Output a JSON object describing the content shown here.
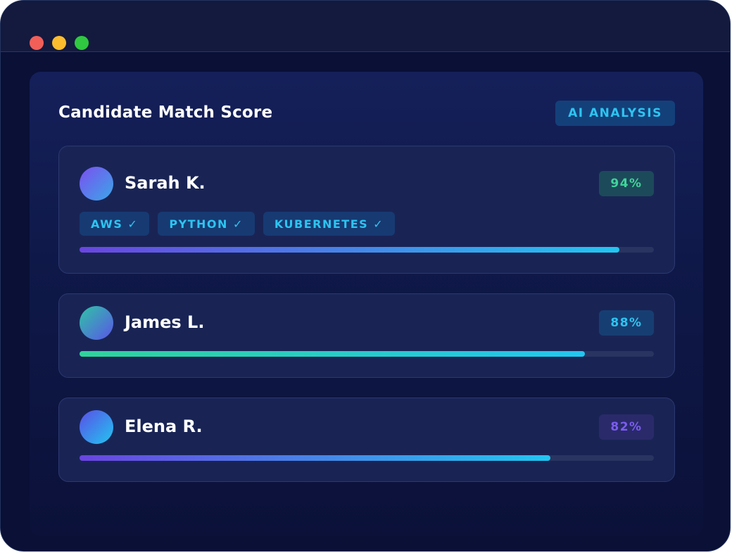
{
  "title": "Candidate Match Score",
  "badge": "AI ANALYSIS",
  "candidates": [
    {
      "name": "Sarah K.",
      "score_label": "94%",
      "match": 0.94,
      "score_color": "#3fd49a",
      "score_bg": "#1d4a5a",
      "avatar_gradient": [
        "#7b4ff0",
        "#3aa7e8"
      ],
      "bar_gradient": [
        "#6a45e0",
        "#22c6f0"
      ],
      "skills": [
        "AWS ✓",
        "PYTHON ✓",
        "KUBERNETES ✓"
      ]
    },
    {
      "name": "James L.",
      "score_label": "88%",
      "match": 0.88,
      "score_color": "#2dc4f0",
      "score_bg": "#173e72",
      "avatar_gradient": [
        "#2fc4a4",
        "#5a55e8"
      ],
      "bar_gradient": [
        "#2ed49a",
        "#22c6f0"
      ],
      "skills": []
    },
    {
      "name": "Elena R.",
      "score_label": "82%",
      "match": 0.82,
      "score_color": "#7b5cf0",
      "score_bg": "#2a2a6a",
      "avatar_gradient": [
        "#5a4ee8",
        "#22c6f0"
      ],
      "bar_gradient": [
        "#6a45e0",
        "#22c6f0"
      ],
      "skills": []
    }
  ]
}
